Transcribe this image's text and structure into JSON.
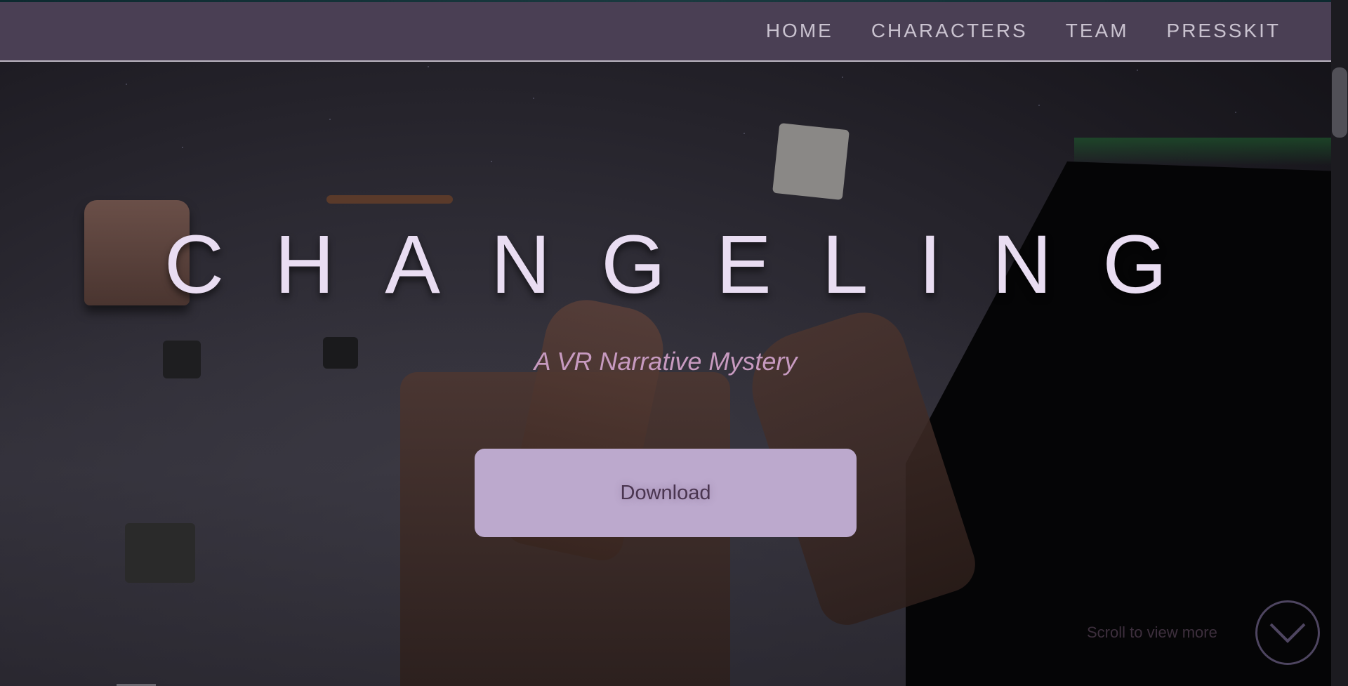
{
  "nav": {
    "links": [
      {
        "label": "HOME"
      },
      {
        "label": "CHARACTERS"
      },
      {
        "label": "TEAM"
      },
      {
        "label": "PRESSKIT"
      }
    ]
  },
  "hero": {
    "title": "CHANGELING",
    "subtitle": "A VR Narrative Mystery",
    "download_label": "Download",
    "scroll_hint": "Scroll to view more"
  },
  "icons": {
    "scroll_down": "chevron-down-icon"
  },
  "colors": {
    "nav_background": "#4a3f54",
    "title": "#e9ddf2",
    "subtitle": "#c79ac0",
    "button": "#bca9cd",
    "button_text": "#4a3550"
  }
}
